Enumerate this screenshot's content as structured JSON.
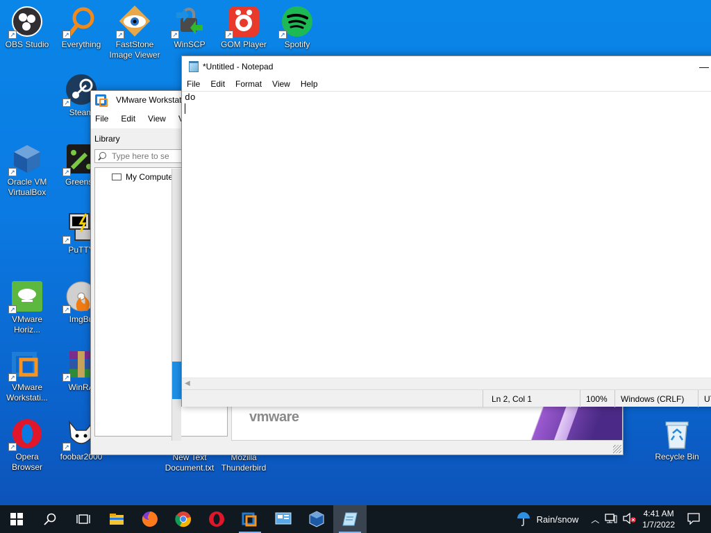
{
  "desktop": {
    "icons": [
      {
        "label": "OBS Studio",
        "icon": "obs-icon"
      },
      {
        "label": "Everything",
        "icon": "everything-icon"
      },
      {
        "label": "FastStone Image Viewer",
        "icon": "faststone-icon"
      },
      {
        "label": "WinSCP",
        "icon": "winscp-icon"
      },
      {
        "label": "GOM Player",
        "icon": "gom-player-icon"
      },
      {
        "label": "Spotify",
        "icon": "spotify-icon"
      },
      {
        "label": "Steam",
        "icon": "steam-icon"
      },
      {
        "label": "Oracle VM VirtualBox",
        "icon": "virtualbox-icon"
      },
      {
        "label": "Greensh",
        "icon": "greenshot-icon"
      },
      {
        "label": "PuTTY",
        "icon": "putty-icon"
      },
      {
        "label": "VMware Horiz...",
        "icon": "vmware-horizon-icon"
      },
      {
        "label": "ImgBu",
        "icon": "imgburn-icon"
      },
      {
        "label": "VMware Workstati...",
        "icon": "vmware-workstation-icon"
      },
      {
        "label": "WinRA",
        "icon": "winrar-icon"
      },
      {
        "label": "Opera Browser",
        "icon": "opera-icon"
      },
      {
        "label": "foobar2000",
        "icon": "foobar2000-icon"
      },
      {
        "label": "New Text Document.txt",
        "icon": "text-file-icon"
      },
      {
        "label": "Mozilla Thunderbird",
        "icon": "thunderbird-icon"
      },
      {
        "label": "Recycle Bin",
        "icon": "recycle-bin-icon"
      }
    ]
  },
  "vmware": {
    "title": "VMware Workstati",
    "menu": [
      "File",
      "Edit",
      "View",
      "V"
    ],
    "library_title": "Library",
    "search_placeholder": "Type here to se",
    "tree_item": "My Compute",
    "logo_text": "vmware"
  },
  "notepad": {
    "title": "*Untitled - Notepad",
    "menu": [
      "File",
      "Edit",
      "Format",
      "View",
      "Help"
    ],
    "content": "do\n",
    "status": {
      "position": "Ln 2, Col 1",
      "zoom": "100%",
      "line_ending": "Windows (CRLF)",
      "encoding": "UT"
    }
  },
  "taskbar": {
    "weather": "Rain/snow",
    "time": "4:41 AM",
    "date": "1/7/2022",
    "colors": {
      "background": "#101820",
      "active": "#3a4450"
    }
  }
}
